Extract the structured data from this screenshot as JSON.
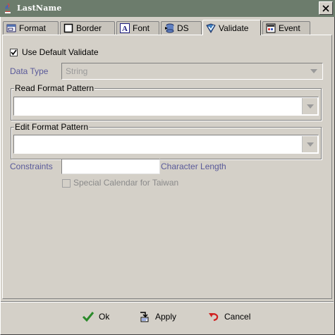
{
  "window": {
    "title": "LastName",
    "close_icon": "close-icon"
  },
  "tabs": [
    {
      "label": "Format",
      "icon": "format-icon"
    },
    {
      "label": "Border",
      "icon": "border-icon"
    },
    {
      "label": "Font",
      "icon": "font-icon"
    },
    {
      "label": "DS",
      "icon": "datasource-icon"
    },
    {
      "label": "Validate",
      "icon": "validate-icon",
      "active": true
    },
    {
      "label": "Event",
      "icon": "event-icon"
    }
  ],
  "validate": {
    "use_default": {
      "label": "Use Default Validate",
      "checked": true
    },
    "data_type": {
      "label": "Data Type",
      "value": "String",
      "enabled": false
    },
    "read_format": {
      "legend": "Read Format Pattern",
      "value": ""
    },
    "edit_format": {
      "legend": "Edit Format Pattern",
      "value": ""
    },
    "constraints": {
      "label": "Constraints",
      "value": "",
      "suffix": "Character Length"
    },
    "special_calendar": {
      "label": "Special Calendar for Taiwan",
      "checked": false,
      "enabled": false
    }
  },
  "buttons": {
    "ok": "Ok",
    "apply": "Apply",
    "cancel": "Cancel"
  },
  "colors": {
    "titlebar": "#6c7c6c",
    "dialog_bg": "#d4d0c8",
    "disabled_label": "#5a5a9a",
    "ok_icon": "#2a8a2a",
    "cancel_icon": "#d02020"
  }
}
